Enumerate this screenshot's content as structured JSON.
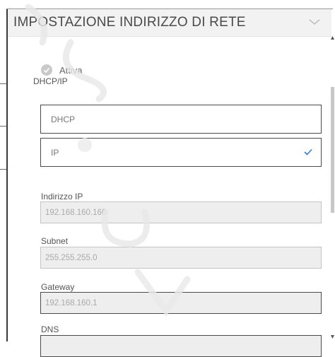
{
  "dialog": {
    "title": "IMPOSTAZIONE INDIRIZZO DI RETE"
  },
  "active_toggle": {
    "label": "Attiva",
    "checked": true
  },
  "dhcp_ip": {
    "label": "DHCP/IP",
    "options": [
      {
        "label": "DHCP",
        "selected": false
      },
      {
        "label": "IP",
        "selected": true
      }
    ]
  },
  "fields": {
    "ip_address": {
      "label": "Indirizzo IP",
      "value": "192.168.160.160"
    },
    "subnet": {
      "label": "Subnet",
      "value": "255.255.255.0"
    },
    "gateway": {
      "label": "Gateway",
      "value": "192.168.160.1"
    },
    "dns": {
      "label": "DNS",
      "value": ""
    }
  },
  "colors": {
    "header_bg": "#f2f2f2",
    "check_color": "#2f7fd1",
    "input_bg": "#eeeeee"
  },
  "icons": {
    "chevron": "chevron-down-icon",
    "check": "check-icon",
    "toggle": "toggle-icon"
  }
}
